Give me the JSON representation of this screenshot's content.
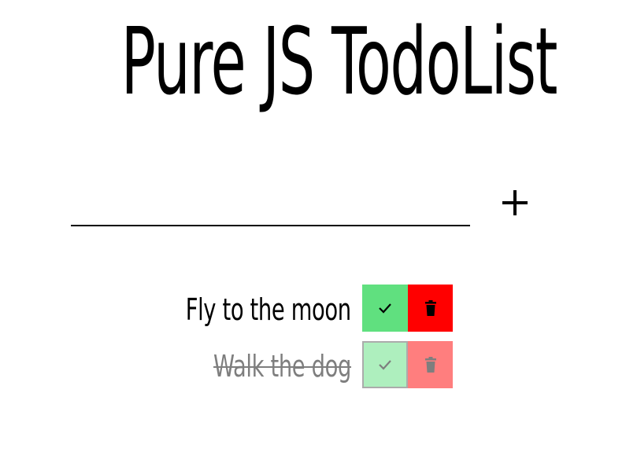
{
  "header": {
    "title": "Pure JS TodoList"
  },
  "form": {
    "input_value": "",
    "add_icon": "plus-icon"
  },
  "todos": [
    {
      "text": "Fly to the moon",
      "completed": false
    },
    {
      "text": "Walk the dog",
      "completed": true
    }
  ],
  "colors": {
    "check_bg": "#60e07f",
    "trash_bg": "#ff0000"
  },
  "icons": {
    "check": "check-icon",
    "trash": "trash-icon"
  }
}
